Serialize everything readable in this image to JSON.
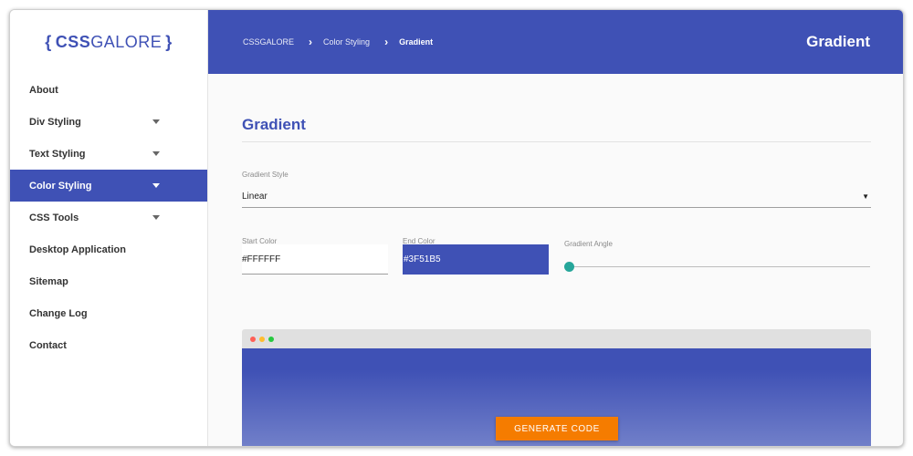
{
  "logo": {
    "open_brace": "{",
    "css": "CSS",
    "galore": "GALORE",
    "close_brace": "}"
  },
  "sidebar": {
    "items": [
      {
        "label": "About",
        "has_caret": false
      },
      {
        "label": "Div Styling",
        "has_caret": true
      },
      {
        "label": "Text Styling",
        "has_caret": true
      },
      {
        "label": "Color Styling",
        "has_caret": true,
        "active": true
      },
      {
        "label": "CSS Tools",
        "has_caret": true
      },
      {
        "label": "Desktop Application",
        "has_caret": false
      },
      {
        "label": "Sitemap",
        "has_caret": false
      },
      {
        "label": "Change Log",
        "has_caret": false
      },
      {
        "label": "Contact",
        "has_caret": false
      }
    ]
  },
  "header": {
    "breadcrumb": [
      "CSSGALORE",
      "Color Styling",
      "Gradient"
    ],
    "title": "Gradient"
  },
  "main": {
    "title": "Gradient",
    "gradient_style": {
      "label": "Gradient Style",
      "value": "Linear"
    },
    "start_color": {
      "label": "Start Color",
      "value": "#FFFFFF"
    },
    "end_color": {
      "label": "End Color",
      "value": "#3F51B5"
    },
    "gradient_angle": {
      "label": "Gradient Angle",
      "value": 0
    },
    "generate_button": "GENERATE CODE"
  },
  "colors": {
    "primary": "#3f51b5",
    "accent_button": "#f57c00",
    "slider_thumb": "#26a69a"
  }
}
